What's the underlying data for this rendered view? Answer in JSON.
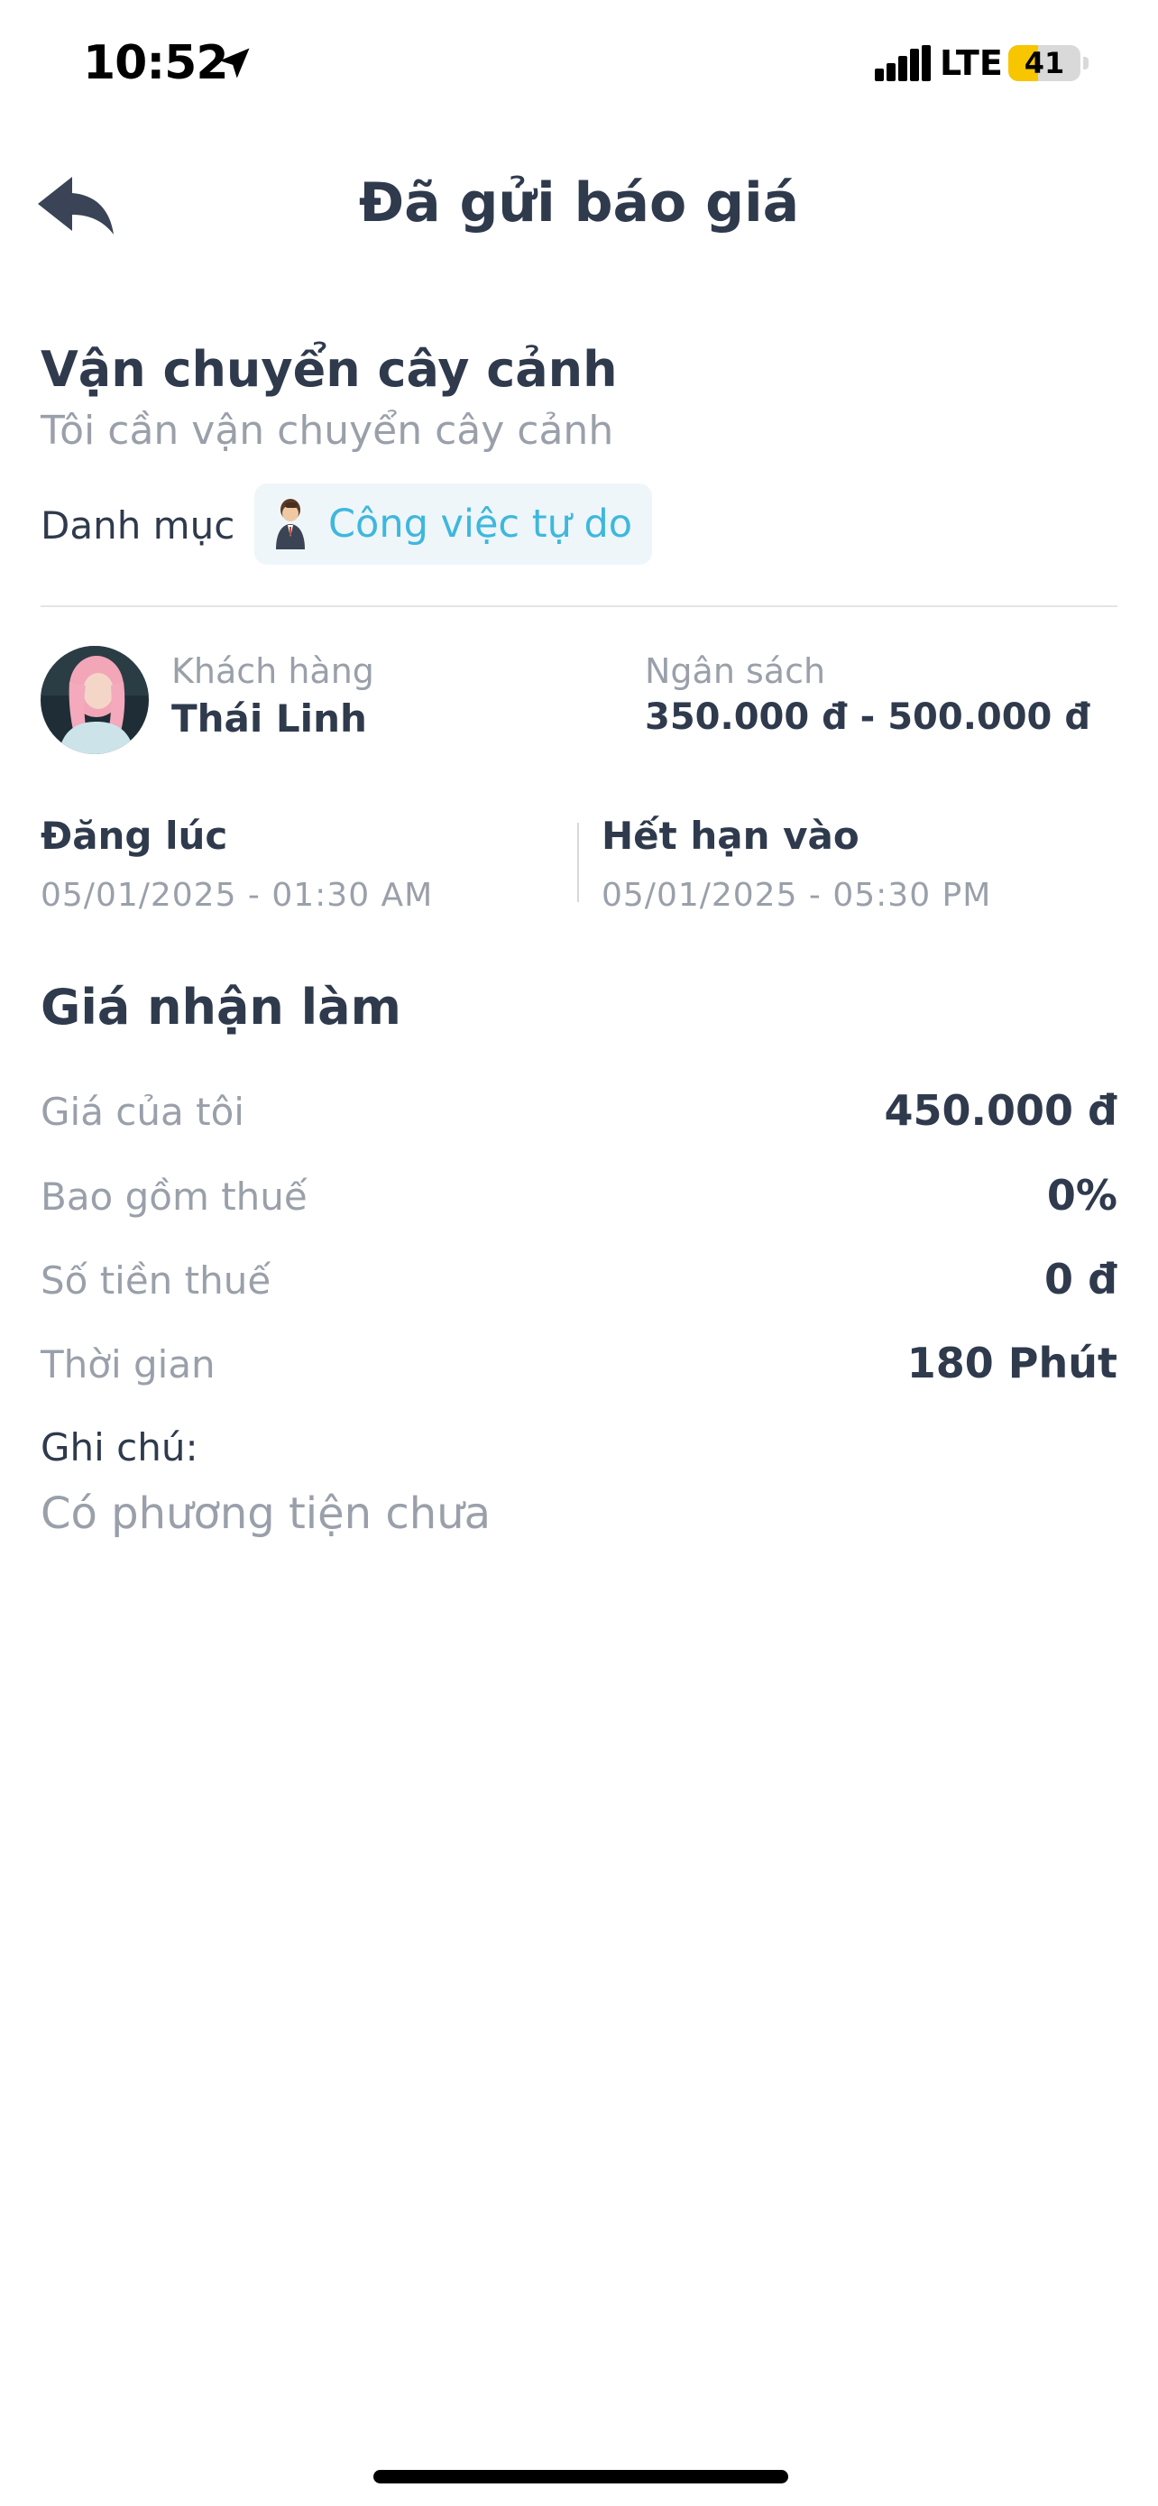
{
  "status_bar": {
    "time": "10:52",
    "network": "LTE",
    "battery": "41",
    "battery_level": 0.41,
    "location_icon": "location-arrow-icon",
    "signal_icon": "cellular-signal-icon"
  },
  "header": {
    "title": "Đã gửi báo giá",
    "back_icon": "reply-arrow-icon"
  },
  "job": {
    "title": "Vận chuyển cây cảnh",
    "description": "Tôi cần vận chuyển cây cảnh",
    "category_label": "Danh mục",
    "category_value": "Công việc tự do",
    "category_icon": "freelancer-avatar-icon"
  },
  "customer": {
    "caption": "Khách hàng",
    "name": "Thái Linh",
    "budget_caption": "Ngân sách",
    "budget_value": "350.000 đ - 500.000 đ"
  },
  "dates": {
    "posted_caption": "Đăng lúc",
    "posted_value": "05/01/2025 - 01:30 AM",
    "expiry_caption": "Hết hạn vào",
    "expiry_value": "05/01/2025 - 05:30 PM"
  },
  "quote": {
    "section_title": "Giá nhận làm",
    "rows": [
      {
        "label": "Giá của tôi",
        "value": "450.000 đ"
      },
      {
        "label": "Bao gồm thuế",
        "value": "0%"
      },
      {
        "label": "Số tiền thuế",
        "value": "0 đ"
      },
      {
        "label": "Thời gian",
        "value": "180 Phút"
      }
    ],
    "note_caption": "Ghi chú:",
    "note_value": "Có phương tiện chưa"
  },
  "colors": {
    "text_primary": "#2f3a4d",
    "text_muted": "#9aa0aa",
    "accent": "#3fb7dd",
    "chip_bg": "#eef6fa",
    "battery": "#f7c600"
  }
}
